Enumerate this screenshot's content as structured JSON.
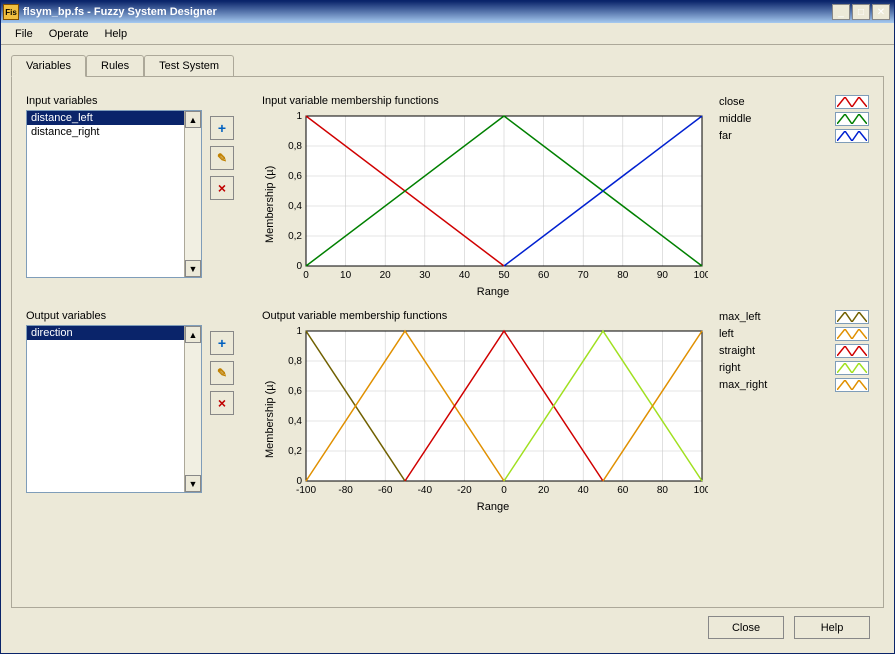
{
  "window": {
    "title": "flsym_bp.fs - Fuzzy System Designer",
    "icon_text": "Fis"
  },
  "menubar": [
    "File",
    "Operate",
    "Help"
  ],
  "tabs": [
    "Variables",
    "Rules",
    "Test System"
  ],
  "active_tab": 0,
  "input_section": {
    "label": "Input variables",
    "items": [
      "distance_left",
      "distance_right"
    ],
    "selected": 0,
    "chart_title": "Input variable membership functions",
    "ylabel": "Membership (µ)",
    "xlabel": "Range",
    "legend": [
      {
        "name": "close",
        "color": "#d00000"
      },
      {
        "name": "middle",
        "color": "#008000"
      },
      {
        "name": "far",
        "color": "#0020d0"
      }
    ]
  },
  "output_section": {
    "label": "Output variables",
    "items": [
      "direction"
    ],
    "selected": 0,
    "chart_title": "Output variable membership functions",
    "ylabel": "Membership (µ)",
    "xlabel": "Range",
    "legend": [
      {
        "name": "max_left",
        "color": "#706000"
      },
      {
        "name": "left",
        "color": "#e09000"
      },
      {
        "name": "straight",
        "color": "#d00000"
      },
      {
        "name": "right",
        "color": "#a0e020"
      },
      {
        "name": "max_right",
        "color": "#e09000"
      }
    ]
  },
  "buttons": {
    "close": "Close",
    "help": "Help"
  },
  "toolbtn_icons": {
    "add": "+",
    "edit": "✎",
    "del": "×"
  },
  "chart_data": [
    {
      "type": "line",
      "title": "Input variable membership functions",
      "xlabel": "Range",
      "ylabel": "Membership (µ)",
      "xlim": [
        0,
        100
      ],
      "ylim": [
        0,
        1
      ],
      "xticks": [
        0,
        10,
        20,
        30,
        40,
        50,
        60,
        70,
        80,
        90,
        100
      ],
      "yticks": [
        0,
        0.2,
        0.4,
        0.6,
        0.8,
        1
      ],
      "series": [
        {
          "name": "close",
          "color": "#d00000",
          "points": [
            [
              0,
              1
            ],
            [
              50,
              0
            ]
          ]
        },
        {
          "name": "middle",
          "color": "#008000",
          "points": [
            [
              0,
              0
            ],
            [
              50,
              1
            ],
            [
              100,
              0
            ]
          ]
        },
        {
          "name": "far",
          "color": "#0020d0",
          "points": [
            [
              50,
              0
            ],
            [
              100,
              1
            ]
          ]
        }
      ]
    },
    {
      "type": "line",
      "title": "Output variable membership functions",
      "xlabel": "Range",
      "ylabel": "Membership (µ)",
      "xlim": [
        -100,
        100
      ],
      "ylim": [
        0,
        1
      ],
      "xticks": [
        -100,
        -80,
        -60,
        -40,
        -20,
        0,
        20,
        40,
        60,
        80,
        100
      ],
      "yticks": [
        0,
        0.2,
        0.4,
        0.6,
        0.8,
        1
      ],
      "series": [
        {
          "name": "max_left",
          "color": "#706000",
          "points": [
            [
              -100,
              1
            ],
            [
              -50,
              0
            ]
          ]
        },
        {
          "name": "left",
          "color": "#e09000",
          "points": [
            [
              -100,
              0
            ],
            [
              -50,
              1
            ],
            [
              0,
              0
            ]
          ]
        },
        {
          "name": "straight",
          "color": "#d00000",
          "points": [
            [
              -50,
              0
            ],
            [
              0,
              1
            ],
            [
              50,
              0
            ]
          ]
        },
        {
          "name": "right",
          "color": "#a0e020",
          "points": [
            [
              0,
              0
            ],
            [
              50,
              1
            ],
            [
              100,
              0
            ]
          ]
        },
        {
          "name": "max_right",
          "color": "#e09000",
          "points": [
            [
              50,
              0
            ],
            [
              100,
              1
            ]
          ]
        }
      ]
    }
  ]
}
